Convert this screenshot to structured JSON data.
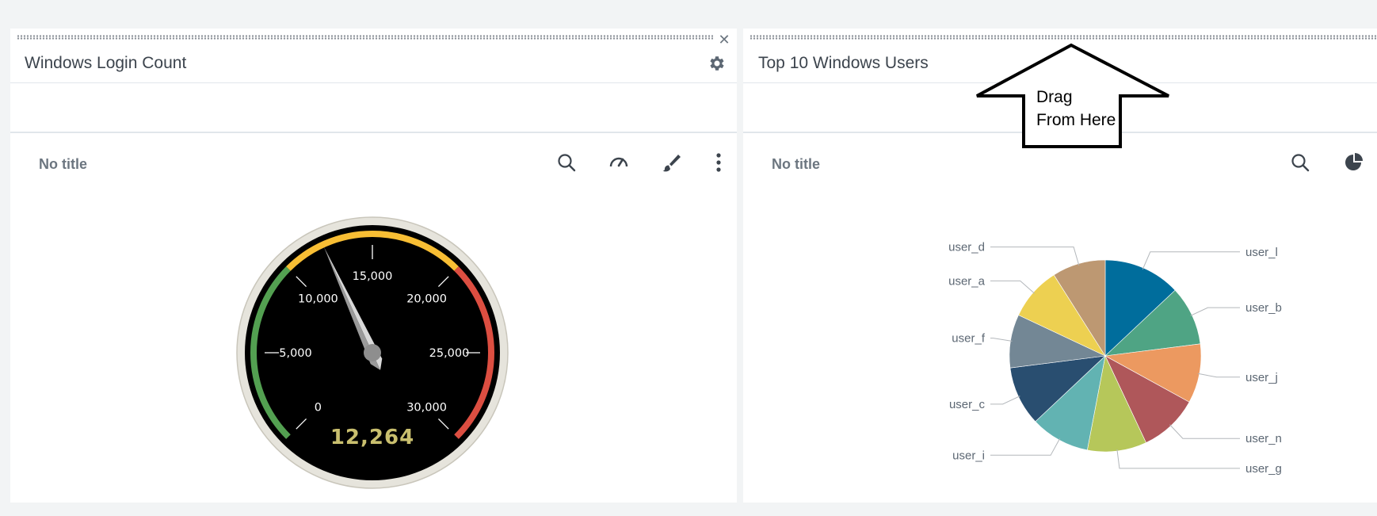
{
  "left_panel": {
    "title": "Windows Login Count",
    "viz_title": "No title",
    "icons": [
      "close-icon",
      "gear-icon",
      "search-icon",
      "gauge-icon",
      "paintbrush-icon",
      "more-vertical-icon"
    ]
  },
  "right_panel": {
    "title": "Top 10 Windows Users",
    "viz_title": "No title",
    "icons": [
      "search-icon",
      "pie-chart-icon"
    ]
  },
  "annotation": {
    "line1": "Drag",
    "line2": "From Here"
  },
  "chart_data": [
    {
      "type": "gauge",
      "value": 12264,
      "value_label": "12,264",
      "range": [
        0,
        30000
      ],
      "ticks": [
        "0",
        "5,000",
        "10,000",
        "15,000",
        "20,000",
        "25,000",
        "30,000"
      ],
      "bands": [
        {
          "from": 0,
          "to": 10000,
          "color": "#53a051"
        },
        {
          "from": 10000,
          "to": 20000,
          "color": "#f8be34"
        },
        {
          "from": 20000,
          "to": 30000,
          "color": "#dc4e41"
        }
      ]
    },
    {
      "type": "pie",
      "categories": [
        "user_l",
        "user_b",
        "user_j",
        "user_n",
        "user_g",
        "user_i",
        "user_c",
        "user_f",
        "user_a",
        "user_d"
      ],
      "values": [
        13,
        10,
        10,
        10,
        10,
        10,
        10,
        9,
        9,
        9
      ],
      "colors": [
        "#006d9c",
        "#4fa484",
        "#ec9960",
        "#af575a",
        "#b6c75a",
        "#62b3b2",
        "#294e70",
        "#738795",
        "#edd051",
        "#bd9872"
      ]
    }
  ]
}
